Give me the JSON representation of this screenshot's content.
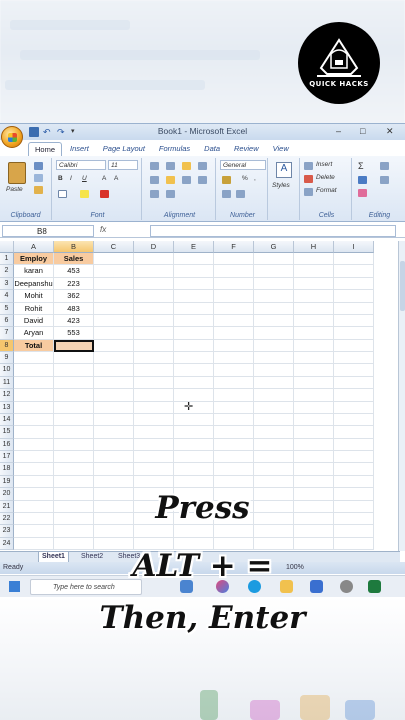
{
  "overlay": {
    "logo_text": "QUICK HACKS",
    "caption_line1": "Press",
    "caption_line2": "ALT + =",
    "caption_line3": "Then, Enter"
  },
  "window": {
    "title": "Book1 - Microsoft Excel",
    "controls": [
      "–",
      "□",
      "✕"
    ]
  },
  "ribbon": {
    "tabs": [
      "Home",
      "Insert",
      "Page Layout",
      "Formulas",
      "Data",
      "Review",
      "View"
    ],
    "active_tab": "Home",
    "font_name": "Calibri",
    "font_size": "11",
    "number_format": "General",
    "groups": [
      "Clipboard",
      "Font",
      "Alignment",
      "Number",
      "Cells",
      "Editing"
    ],
    "paste_label": "Paste",
    "styles_label": "Styles",
    "insert_label": "Insert",
    "delete_label": "Delete",
    "format_label": "Format"
  },
  "formula_bar": {
    "name_box": "B8",
    "fx": "fx",
    "content": ""
  },
  "sheet": {
    "columns": [
      "A",
      "B",
      "C",
      "D",
      "E",
      "F",
      "G",
      "H",
      "I"
    ],
    "selected_column": "B",
    "selected_row": 8,
    "header": [
      "Employ",
      "Sales"
    ],
    "rows": [
      [
        "karan",
        "453"
      ],
      [
        "Deepanshu",
        "223"
      ],
      [
        "Mohit",
        "362"
      ],
      [
        "Rohit",
        "483"
      ],
      [
        "David",
        "423"
      ],
      [
        "Aryan",
        "553"
      ]
    ],
    "total_label": "Total",
    "total_value": "",
    "row_count": 24,
    "tabs": [
      "Sheet1",
      "Sheet2",
      "Sheet3"
    ],
    "active_tab": "Sheet1"
  },
  "status": {
    "ready": "Ready",
    "zoom": "100%"
  },
  "taskbar": {
    "search_placeholder": "Type here to search"
  },
  "colors": {
    "header_fill": "#f8cba0",
    "selected_header": "#f5c66e",
    "ribbon_blue": "#dbe6f4"
  }
}
